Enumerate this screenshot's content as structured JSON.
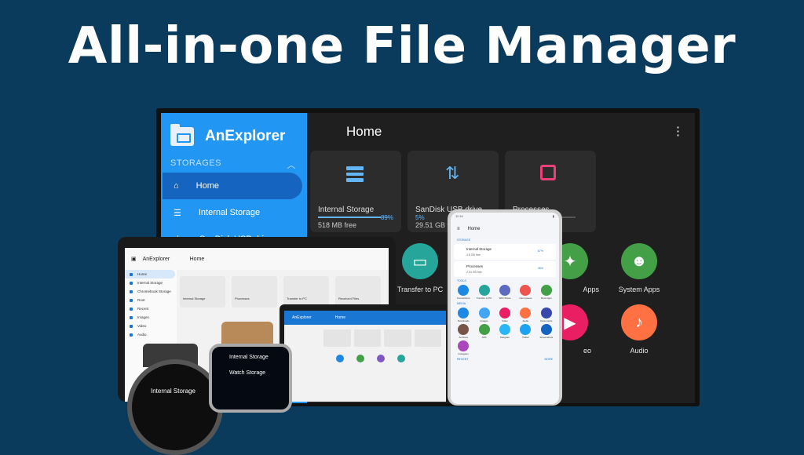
{
  "headline": "All-in-one File Manager",
  "tv": {
    "brand": "AnExplorer",
    "section": "STORAGES",
    "nav": [
      "Home",
      "Internal Storage",
      "SanDisk USB drive"
    ],
    "title": "Home",
    "cards": [
      {
        "name": "Internal Storage",
        "percent": "89%",
        "sub": "518 MB free",
        "fill": 0.89,
        "icon": "storage-icon",
        "color": "#64b5f6"
      },
      {
        "name": "SanDisk USB drive",
        "percent": "5%",
        "sub": "29.51 GB free",
        "fill": 0.05,
        "icon": "usb-icon",
        "color": "#64b5f6"
      },
      {
        "name": "Processes",
        "percent": "",
        "sub": "",
        "fill": 0.5,
        "icon": "chip-icon",
        "color": "#ec407a"
      }
    ],
    "tools": [
      {
        "label": "Transfer to PC",
        "color": "#26a69a",
        "icon": "transfer-icon"
      },
      {
        "label": "Apps",
        "color": "#43a047",
        "icon": "apps-icon"
      },
      {
        "label": "System Apps",
        "color": "#43a047",
        "icon": "android-icon"
      },
      {
        "label": "eo",
        "color": "#e91e63",
        "icon": "video-icon"
      },
      {
        "label": "Audio",
        "color": "#ff7043",
        "icon": "music-icon"
      }
    ]
  },
  "tablet": {
    "brand": "AnExplorer",
    "title": "Home",
    "nav": [
      "Home",
      "Internal Storage",
      "Chromebook Storage",
      "Root",
      "Recent",
      "Images",
      "Video",
      "Audio"
    ],
    "cards": [
      "Internal Storage",
      "Processes",
      "Transfer to PC",
      "Received Files"
    ]
  },
  "small_tablet": {
    "brand": "AnExplorer",
    "title": "Home"
  },
  "phone": {
    "time": "11:34",
    "title": "Home",
    "sections": [
      "STORAGE",
      "TOOLS",
      "MEDIA",
      "RECENT"
    ],
    "storage_rows": [
      {
        "name": "Internal Storage",
        "pct": "67%",
        "sub": "4.8 GB free"
      },
      {
        "name": "Processes",
        "pct": "46%",
        "sub": "2.04 GB free"
      }
    ],
    "tools": [
      "Connections",
      "Transfer to PC",
      "WiFi Share",
      "Cast Queue",
      "Root Apps"
    ],
    "media": [
      "Downloads",
      "Images",
      "Video",
      "Audio",
      "Documents",
      "Archives",
      "APK",
      "Telegram",
      "Twitter",
      "Screenshots",
      "Instagram"
    ],
    "more": "MORE"
  },
  "watches": {
    "w1": {
      "label": "Internal Storage"
    },
    "w2": {
      "label1": "Internal Storage",
      "label2": "Watch Storage"
    }
  }
}
